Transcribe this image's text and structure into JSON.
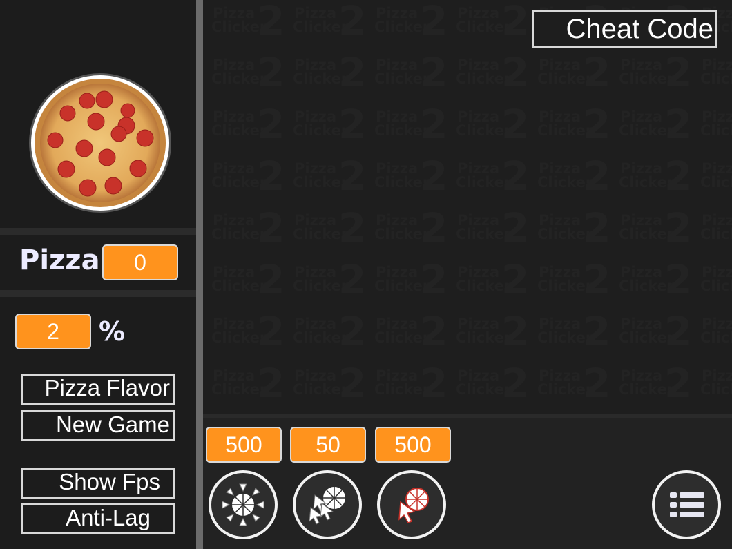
{
  "header": {
    "cheat_code_label": "Cheat Code"
  },
  "counter": {
    "label": "Pizza",
    "value": "0"
  },
  "percent": {
    "value": "2",
    "symbol": "%"
  },
  "menu": {
    "pizza_flavor": "Pizza Flavor",
    "new_game": "New Game",
    "show_fps": "Show Fps",
    "anti_lag": "Anti-Lag"
  },
  "upgrades": [
    {
      "cost": "500",
      "icon": "auto-click-pizza-icon"
    },
    {
      "cost": "50",
      "icon": "multi-cursor-pizza-icon"
    },
    {
      "cost": "500",
      "icon": "cursor-pizza-icon"
    }
  ],
  "background_tile": {
    "line1": "Pizza",
    "line2": "Clicker",
    "line3": "2"
  },
  "icons": {
    "pizza": "pepperoni-pizza-icon",
    "list": "list-menu-icon"
  },
  "colors": {
    "accent": "#ff931d",
    "background": "#1a1a1a",
    "pepperoni": "#c8322a",
    "cheese": "#e9b868"
  }
}
